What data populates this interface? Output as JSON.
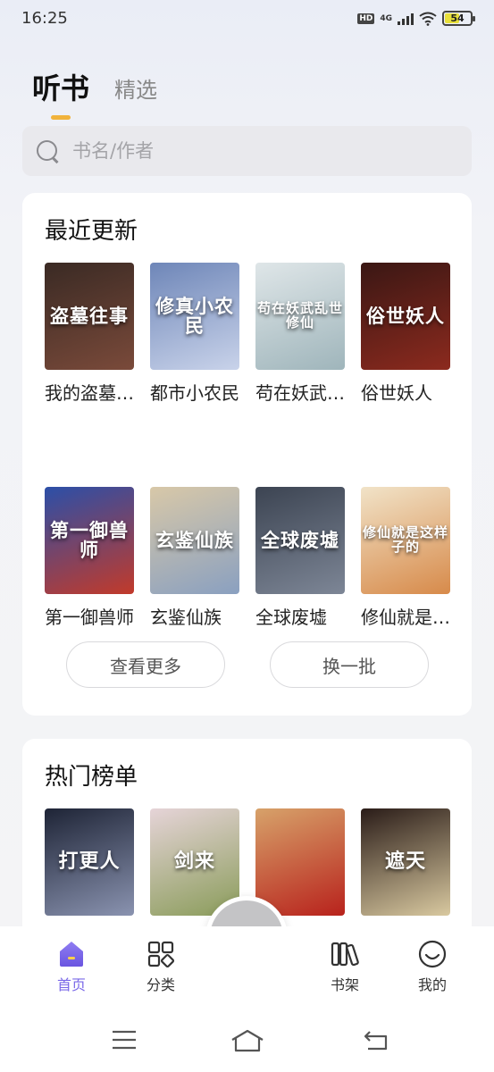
{
  "status_bar": {
    "time": "16:25",
    "hd": "HD",
    "network": "4G",
    "battery": "54"
  },
  "header": {
    "tab_active": "听书",
    "tab_other": "精选"
  },
  "search": {
    "placeholder": "书名/作者"
  },
  "recent": {
    "title": "最近更新",
    "books": [
      {
        "name": "我的盗墓往事",
        "cover_text": "盗墓往事",
        "colors": [
          "#3a2a24",
          "#7a4a3a"
        ]
      },
      {
        "name": "都市小农民",
        "cover_text": "修真小农民",
        "colors": [
          "#6e86b8",
          "#c9d3ea"
        ]
      },
      {
        "name": "苟在妖武乱世修仙",
        "cover_text": "苟在妖武乱世修仙",
        "colors": [
          "#dfe6e8",
          "#9fb5bb"
        ]
      },
      {
        "name": "俗世妖人",
        "cover_text": "俗世妖人",
        "colors": [
          "#3a1714",
          "#8c2a1e"
        ]
      },
      {
        "name": "第一御兽师",
        "cover_text": "第一御兽师",
        "colors": [
          "#2b4fa8",
          "#c23a2a"
        ]
      },
      {
        "name": "玄鉴仙族",
        "cover_text": "玄鉴仙族",
        "colors": [
          "#d8c8a8",
          "#8aa0c0"
        ]
      },
      {
        "name": "全球废墟",
        "cover_text": "全球废墟",
        "colors": [
          "#3c4452",
          "#7d8696"
        ]
      },
      {
        "name": "修仙就是这样子的",
        "cover_text": "修仙就是这样子的",
        "colors": [
          "#f1e3c8",
          "#d78a4a"
        ]
      }
    ],
    "more_button": "查看更多",
    "refresh_button": "换一批"
  },
  "hot": {
    "title": "热门榜单",
    "books": [
      {
        "cover_text": "打更人",
        "colors": [
          "#1e2436",
          "#8a93b0"
        ]
      },
      {
        "cover_text": "剑来",
        "colors": [
          "#e6d4d8",
          "#8a9c5a"
        ]
      },
      {
        "cover_text": "",
        "colors": [
          "#d7a26a",
          "#b8221c"
        ]
      },
      {
        "cover_text": "遮天",
        "colors": [
          "#2a1c18",
          "#d9c9a0"
        ]
      }
    ]
  },
  "bottom_nav": {
    "home": "首页",
    "category": "分类",
    "shelf": "书架",
    "mine": "我的"
  },
  "colors": {
    "accent": "#7a68e8",
    "tab_underline": "#f1b33c",
    "play": "#f5a623"
  }
}
